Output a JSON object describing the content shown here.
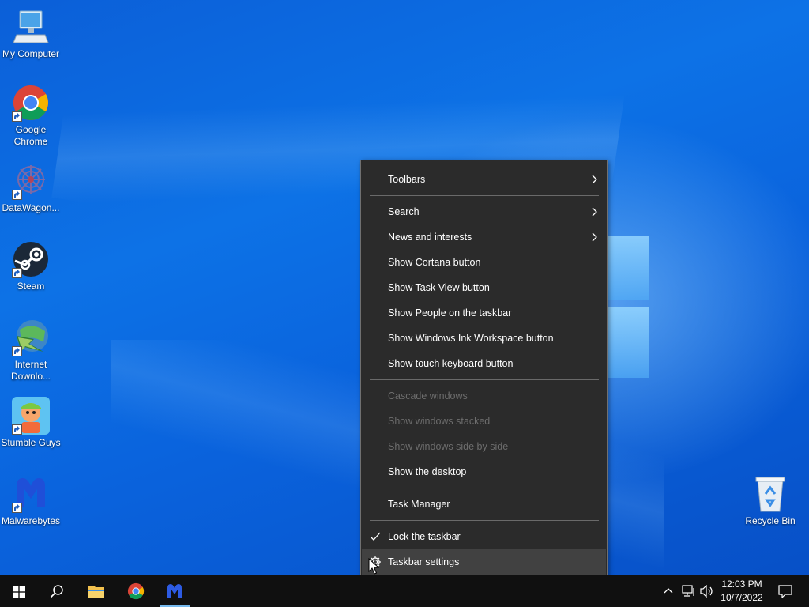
{
  "desktop": {
    "icons": [
      {
        "id": "my-computer",
        "label": "My Computer"
      },
      {
        "id": "google-chrome",
        "label": "Google\nChrome"
      },
      {
        "id": "datawagon",
        "label": "DataWagon..."
      },
      {
        "id": "steam",
        "label": "Steam"
      },
      {
        "id": "internet-download-manager",
        "label": "Internet\nDownlo..."
      },
      {
        "id": "stumble-guys",
        "label": "Stumble Guys"
      },
      {
        "id": "malwarebytes",
        "label": "Malwarebytes"
      },
      {
        "id": "recycle-bin",
        "label": "Recycle Bin"
      }
    ]
  },
  "context_menu": {
    "items": [
      {
        "label": "Toolbars",
        "submenu": true,
        "enabled": true
      },
      {
        "label": "Search",
        "submenu": true,
        "enabled": true
      },
      {
        "label": "News and interests",
        "submenu": true,
        "enabled": true
      },
      {
        "label": "Show Cortana button",
        "enabled": true
      },
      {
        "label": "Show Task View button",
        "enabled": true
      },
      {
        "label": "Show People on the taskbar",
        "enabled": true
      },
      {
        "label": "Show Windows Ink Workspace button",
        "enabled": true
      },
      {
        "label": "Show touch keyboard button",
        "enabled": true
      },
      {
        "label": "Cascade windows",
        "enabled": false
      },
      {
        "label": "Show windows stacked",
        "enabled": false
      },
      {
        "label": "Show windows side by side",
        "enabled": false
      },
      {
        "label": "Show the desktop",
        "enabled": true
      },
      {
        "label": "Task Manager",
        "enabled": true
      },
      {
        "label": "Lock the taskbar",
        "enabled": true,
        "checked": true
      },
      {
        "label": "Taskbar settings",
        "enabled": true,
        "icon": "gear-icon",
        "hovered": true
      }
    ]
  },
  "taskbar": {
    "start_icon": "windows-start-icon",
    "search_icon": "search-icon",
    "pinned": [
      {
        "id": "file-explorer",
        "icon": "folder-icon"
      },
      {
        "id": "chrome",
        "icon": "chrome-icon"
      },
      {
        "id": "malwarebytes",
        "icon": "malwarebytes-icon",
        "active": true
      }
    ],
    "tray_icons": [
      "chevron-up-icon",
      "network-icon",
      "volume-icon"
    ],
    "clock": {
      "time": "12:03 PM",
      "date": "10/7/2022"
    },
    "notification_icon": "action-center-icon"
  },
  "colors": {
    "menu_bg": "#2b2b2b",
    "menu_hover": "#414141",
    "menu_text": "#ffffff",
    "menu_disabled": "#6d6d6d",
    "taskbar_bg": "#101010",
    "accent": "#76b9ed"
  }
}
